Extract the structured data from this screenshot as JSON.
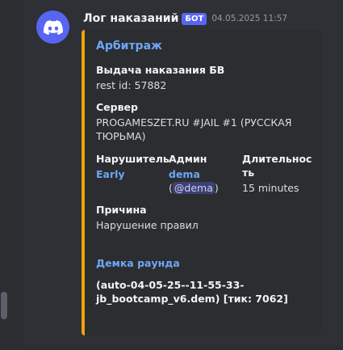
{
  "message": {
    "username": "Лог наказаний",
    "bot_badge": "БОТ",
    "timestamp": "04.05.2025 11:57"
  },
  "embed": {
    "accent_color": "#f0a20b",
    "title": "Арбитраж",
    "punishment": {
      "name": "Выдача наказания БВ",
      "value": "rest id: 57882"
    },
    "server": {
      "name": "Сервер",
      "value_line1": "PROGAMESZET.RU #JAIL #1 (РУССКАЯ",
      "value_line2": "ТЮРЬМА)"
    },
    "violator": {
      "name": "Нарушитель",
      "value": "Early"
    },
    "admin": {
      "name": "Админ",
      "value": "dema",
      "mention_open": "(",
      "mention": "@dema",
      "mention_close": ")"
    },
    "duration": {
      "name_line1": "Длительнос",
      "name_line2": "ть",
      "value": "15 minutes"
    },
    "reason": {
      "name": "Причина",
      "value": "Нарушение правил"
    },
    "demo": {
      "name": "Демка раунда",
      "value_line1": "(auto-04-05-25--11-55-33-",
      "value_line2": "jb_bootcamp_v6.dem) [тик: 7062]"
    }
  }
}
